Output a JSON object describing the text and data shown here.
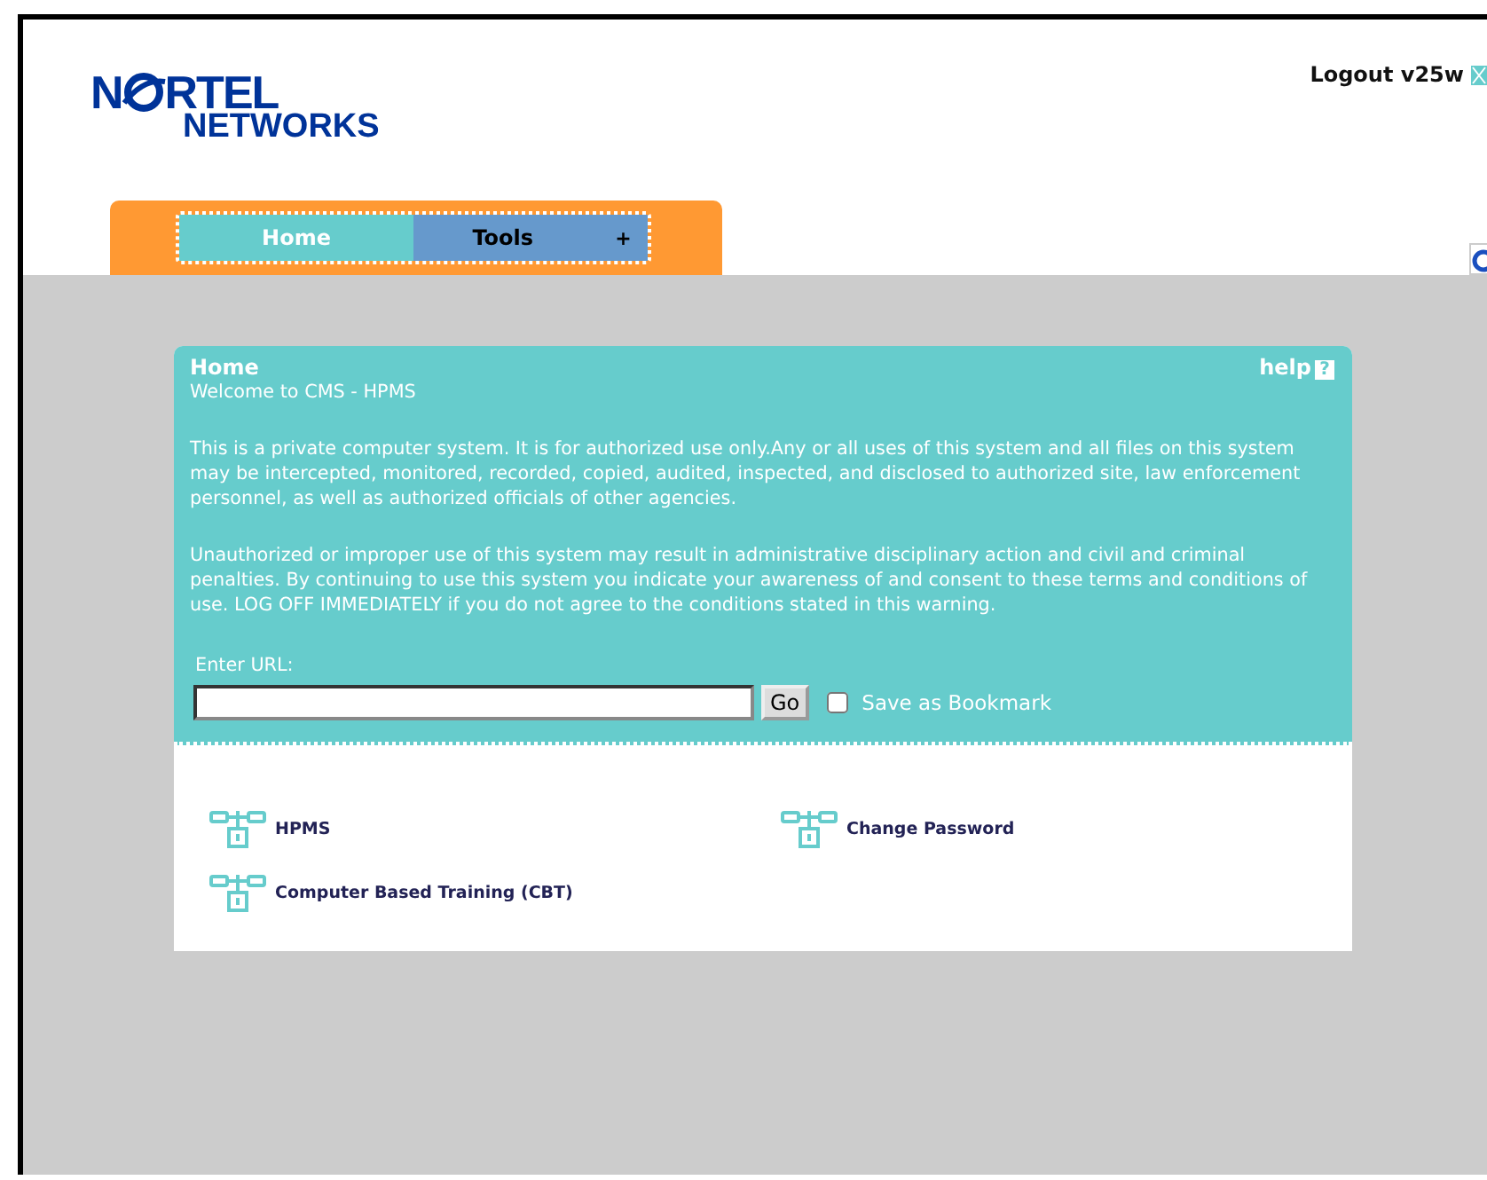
{
  "header": {
    "logo": {
      "line_1_start": "N",
      "line_1_end": "RTEL",
      "line_2": "NETWORKS"
    },
    "logout": "Logout v25w"
  },
  "tabs": [
    {
      "label": "Home",
      "selected": true
    },
    {
      "label": "Tools",
      "selected": false,
      "menu_glyph": "+"
    }
  ],
  "panel": {
    "title": "Home",
    "help": "help",
    "help_glyph": "?",
    "welcome": "Welcome to CMS - HPMS",
    "paragraphs": [
      "This is a private computer system. It is for authorized use only.Any or all uses of this system and all files on this system may be intercepted, monitored, recorded, copied, audited, inspected, and disclosed to authorized site, law enforcement personnel, as well as authorized officials of other agencies.",
      "Unauthorized or improper use of this system may result in administrative disciplinary action and civil and criminal penalties. By continuing to use this system you indicate your awareness of and consent to these terms and conditions of use. LOG OFF IMMEDIATELY if you do not agree to the conditions stated in this warning."
    ],
    "url_label": "Enter URL:",
    "go": "Go",
    "bookmark": {
      "label": "Save as Bookmark",
      "checked": false
    }
  },
  "link_rows": [
    [
      {
        "label": "HPMS"
      },
      {
        "label": "Change Password"
      }
    ],
    [
      {
        "label": "Computer Based Training (CBT)"
      }
    ]
  ]
}
